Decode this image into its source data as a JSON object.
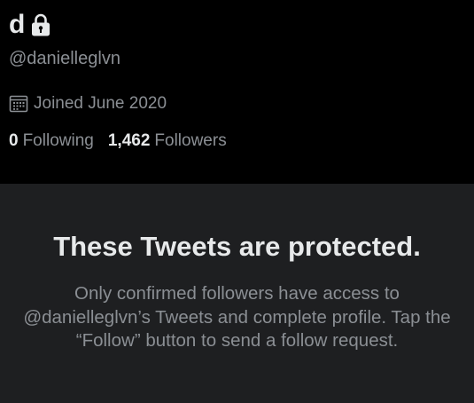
{
  "profile": {
    "display_name": "d",
    "username": "@danielleglvn",
    "joined": "Joined June 2020",
    "following_count": "0",
    "following_label": "Following",
    "followers_count": "1,462",
    "followers_label": "Followers",
    "lock_icon": "lock-icon",
    "calendar_icon": "calendar-icon"
  },
  "protected": {
    "title": "These Tweets are protected.",
    "body": "Only confirmed followers have access to @danielleglvn’s Tweets and complete profile. Tap the “Follow” button to send a follow request."
  },
  "colors": {
    "background": "#000000",
    "panel": "#1e1f21",
    "primary_text": "#e7e9ea",
    "secondary_text": "#8b8f94"
  }
}
